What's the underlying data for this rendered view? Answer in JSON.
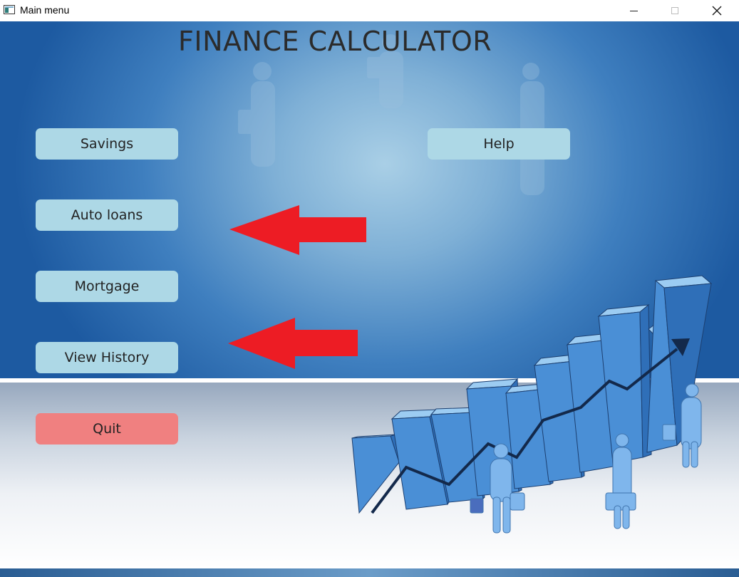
{
  "window": {
    "title": "Main menu",
    "controls": [
      "minimize",
      "maximize",
      "close"
    ]
  },
  "app": {
    "title": "FINANCE CALCULATOR"
  },
  "menu": {
    "savings_label": "Savings",
    "auto_loans_label": "Auto loans",
    "mortgage_label": "Mortgage",
    "view_history_label": "View History",
    "help_label": "Help",
    "quit_label": "Quit"
  },
  "colors": {
    "button_bg": "#add8e6",
    "quit_bg": "#f08080",
    "annotation_arrow": "#ed1c24",
    "background_top": "#1d5aa1",
    "chart_bars": "#4a8fd6"
  },
  "icons": {
    "app": "app-window-icon",
    "minimize": "minimize-icon",
    "maximize": "maximize-icon",
    "close": "close-icon",
    "annotations": [
      "left-arrow-icon",
      "left-arrow-icon"
    ],
    "illustration": "growth-bar-chart-illustration"
  }
}
